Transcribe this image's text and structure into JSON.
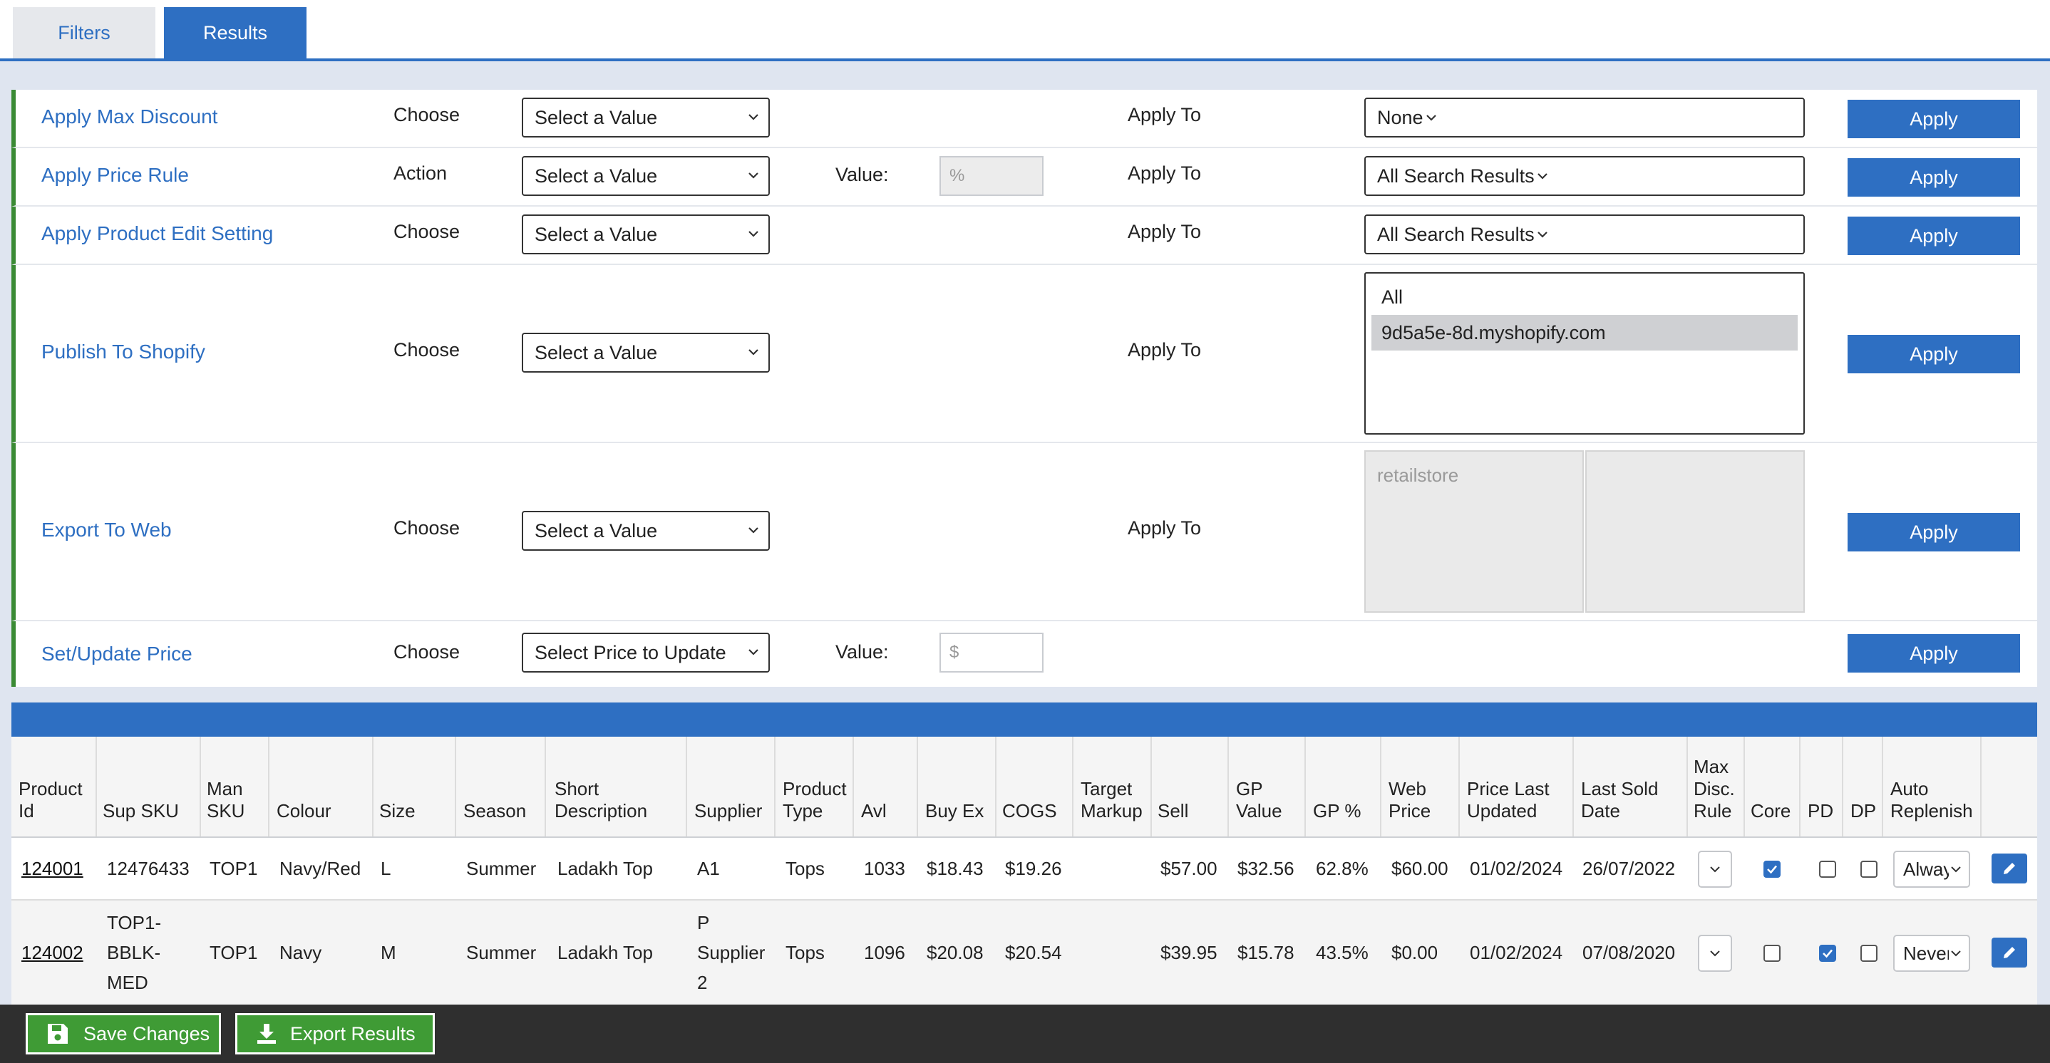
{
  "tabs": {
    "filters": "Filters",
    "results": "Results"
  },
  "actions": {
    "max_discount": {
      "label": "Apply Max Discount",
      "choose": "Choose",
      "select": "Select a Value",
      "apply_to": "Apply To",
      "target": "None",
      "button": "Apply"
    },
    "price_rule": {
      "label": "Apply Price Rule",
      "choose": "Action",
      "select": "Select a Value",
      "value_label": "Value:",
      "value_placeholder": "%",
      "apply_to": "Apply To",
      "target": "All Search Results",
      "button": "Apply"
    },
    "product_edit": {
      "label": "Apply Product Edit Setting",
      "choose": "Choose",
      "select": "Select a Value",
      "apply_to": "Apply To",
      "target": "All Search Results",
      "button": "Apply"
    },
    "shopify": {
      "label": "Publish To Shopify",
      "choose": "Choose",
      "select": "Select a Value",
      "apply_to": "Apply To",
      "options": [
        "All",
        "9d5a5e-8d.myshopify.com"
      ],
      "button": "Apply"
    },
    "export_web": {
      "label": "Export To Web",
      "choose": "Choose",
      "select": "Select a Value",
      "apply_to": "Apply To",
      "store_placeholder": "retailstore",
      "button": "Apply"
    },
    "set_price": {
      "label": "Set/Update Price",
      "choose": "Choose",
      "select": "Select Price to Update",
      "value_label": "Value:",
      "value_placeholder": "$",
      "button": "Apply"
    }
  },
  "table": {
    "headers": {
      "product_id": "Product\nId",
      "sup_sku": "Sup SKU",
      "man_sku": "Man\nSKU",
      "colour": "Colour",
      "size": "Size",
      "season": "Season",
      "short_desc": "Short\nDescription",
      "supplier": "Supplier",
      "product_type": "Product\nType",
      "avl": "Avl",
      "buy_ex": "Buy Ex",
      "cogs": "COGS",
      "target_markup": "Target\nMarkup",
      "sell": "Sell",
      "gp_value": "GP\nValue",
      "gp_pct": "GP %",
      "web_price": "Web\nPrice",
      "price_last_updated": "Price Last\nUpdated",
      "last_sold_date": "Last Sold\nDate",
      "max_disc_rule": "Max\nDisc.\nRule",
      "core": "Core",
      "pd": "PD",
      "dp": "DP",
      "auto_replenish": "Auto\nReplenish"
    },
    "rows": [
      {
        "product_id": "124001",
        "sup_sku": "12476433",
        "man_sku": "TOP1",
        "colour": "Navy/Red",
        "size": "L",
        "season": "Summer",
        "short_desc": "Ladakh Top",
        "supplier": "A1",
        "product_type": "Tops",
        "avl": "1033",
        "buy_ex": "$18.43",
        "cogs": "$19.26",
        "target_markup": "",
        "sell": "$57.00",
        "gp_value": "$32.56",
        "gp_pct": "62.8%",
        "web_price": "$60.00",
        "price_last_updated": "01/02/2024",
        "last_sold_date": "26/07/2022",
        "core": true,
        "pd": false,
        "dp": false,
        "auto_replenish": "Always"
      },
      {
        "product_id": "124002",
        "sup_sku": "TOP1-\nBBLK-\nMED",
        "man_sku": "TOP1",
        "colour": "Navy",
        "size": "M",
        "season": "Summer",
        "short_desc": "Ladakh Top",
        "supplier": "P\nSupplier\n2",
        "product_type": "Tops",
        "avl": "1096",
        "buy_ex": "$20.08",
        "cogs": "$20.54",
        "target_markup": "",
        "sell": "$39.95",
        "gp_value": "$15.78",
        "gp_pct": "43.5%",
        "web_price": "$0.00",
        "price_last_updated": "01/02/2024",
        "last_sold_date": "07/08/2020",
        "core": false,
        "pd": true,
        "dp": false,
        "auto_replenish": "Never"
      }
    ]
  },
  "footer": {
    "save": "Save Changes",
    "export": "Export Results"
  },
  "colors": {
    "accent": "#2e6fc2",
    "action_border": "#3a8a34",
    "footer_button": "#3f9b35",
    "footer_bg": "#2f2f2f"
  }
}
